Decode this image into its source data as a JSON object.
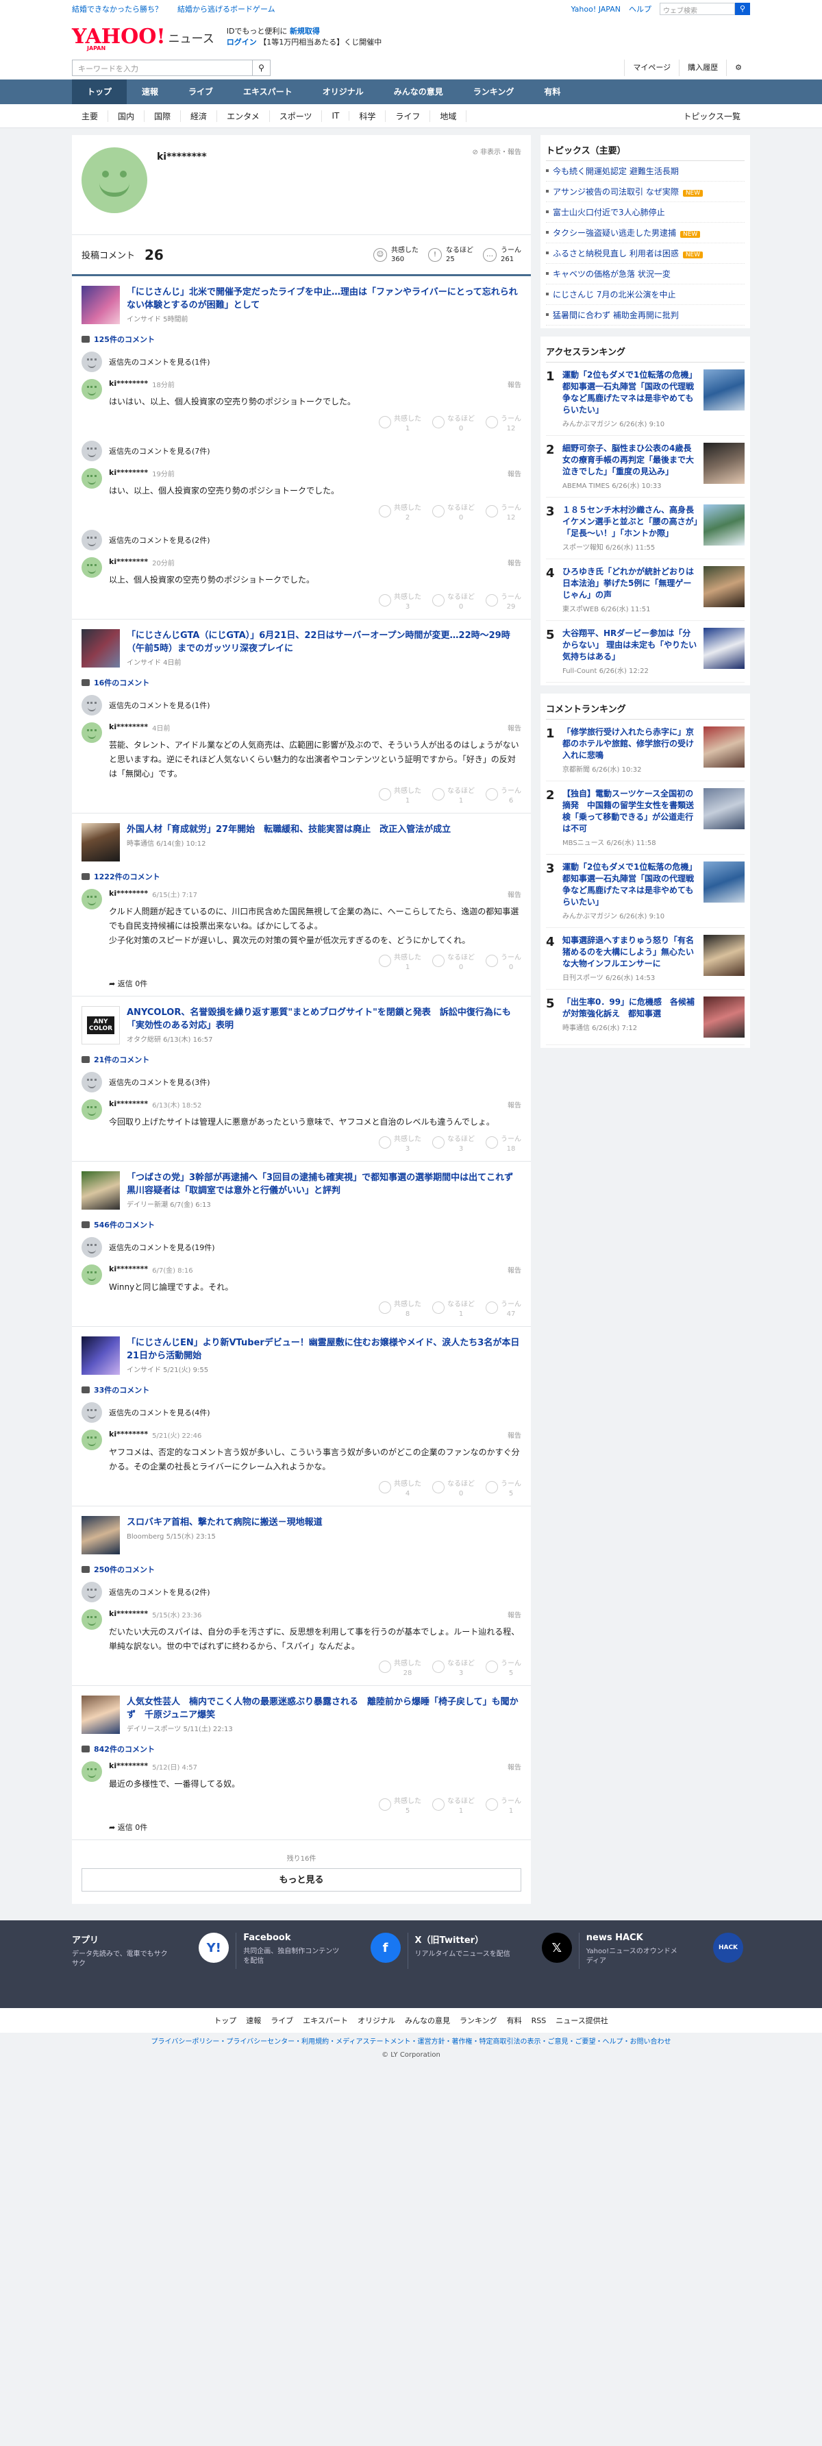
{
  "topbar": {
    "link1": "結婚できなかったら勝ち？",
    "link2": "結婚から逃げるボードゲーム",
    "yjapan": "Yahoo! JAPAN",
    "help": "ヘルプ",
    "search_placeholder": "ウェブ検索"
  },
  "logo": {
    "main": "YAHOO!",
    "sub": "JAPAN",
    "news": "ニュース"
  },
  "promo": {
    "line1_a": "IDでもっと便利に",
    "line1_b": "新規取得",
    "line2_a": "ログイン",
    "line2_b": "【1等1万円相当あたる】くじ開催中"
  },
  "search": {
    "placeholder": "キーワードを入力",
    "mypage": "マイページ",
    "history": "購入履歴"
  },
  "nav": [
    "トップ",
    "速報",
    "ライブ",
    "エキスパート",
    "オリジナル",
    "みんなの意見",
    "ランキング",
    "有料"
  ],
  "subnav": [
    "主要",
    "国内",
    "国際",
    "経済",
    "エンタメ",
    "スポーツ",
    "IT",
    "科学",
    "ライフ",
    "地域"
  ],
  "subnav_right": "トピックス一覧",
  "profile": {
    "name": "ki********",
    "hidden": "非表示・報告",
    "comments_label": "投稿コメント",
    "comments_count": "26",
    "reactions": [
      {
        "label": "共感した",
        "value": "360"
      },
      {
        "label": "なるほど",
        "value": "25"
      },
      {
        "label": "うーん",
        "value": "261"
      }
    ]
  },
  "articles": [
    {
      "title": "「にじさんじ」北米で開催予定だったライブを中止…理由は「ファンやライバーにとって忘れられない体験とするのが困難」として",
      "meta": "インサイド 5時間前",
      "ccount": "125件のコメント",
      "items": [
        {
          "parent": "返信先のコメントを見る(1件)",
          "time": "18分前",
          "text": "はいはい、以上、個人投資家の空売り勢のポジショトークでした。",
          "r": [
            "1",
            "0",
            "12"
          ]
        },
        {
          "parent": "返信先のコメントを見る(7件)",
          "time": "19分前",
          "text": "はい、以上、個人投資家の空売り勢のポジショトークでした。",
          "r": [
            "2",
            "0",
            "12"
          ]
        },
        {
          "parent": "返信先のコメントを見る(2件)",
          "time": "20分前",
          "text": "以上、個人投資家の空売り勢のポジショトークでした。",
          "r": [
            "3",
            "0",
            "29"
          ]
        }
      ]
    },
    {
      "title": "「にじさんじGTA（にじGTA）」6月21日、22日はサーバーオープン時間が変更…22時〜29時（午前5時）までのガッツリ深夜プレイに",
      "meta": "インサイド 4日前",
      "ccount": "16件のコメント",
      "items": [
        {
          "parent": "返信先のコメントを見る(1件)",
          "time": "4日前",
          "text": "芸能、タレント、アイドル業などの人気商売は、広範囲に影響が及ぶので、そういう人が出るのはしょうがないと思いますね。逆にそれほど人気ないくらい魅力的な出演者やコンテンツという証明ですから。「好き」の反対は「無関心」です。",
          "r": [
            "1",
            "1",
            "6"
          ]
        }
      ]
    },
    {
      "title": "外国人材「育成就労」27年開始　転職緩和、技能実習は廃止　改正入管法が成立",
      "meta": "時事通信 6/14(金) 10:12",
      "ccount": "1222件のコメント",
      "items": [
        {
          "parent": "",
          "time": "6/15(土) 7:17",
          "text": "クルド人問題が起きているのに、川口市民含めた国民無視して企業の為に、へーこらしてたら、逸迦の都知事選でも自民支持候補には投票出来ないね。ばかにしてるよ。\n少子化対策のスピードが遅いし、異次元の対策の質や量が低次元すぎるのを、どうにかしてくれ。",
          "r": [
            "1",
            "0",
            "0"
          ],
          "reply": "返信 0件"
        }
      ]
    },
    {
      "title": "ANYCOLOR、名誉毀損を繰り返す悪質\"まとめブログサイト\"を閉鎖と発表　訴訟中復行為にも「実効性のある対応」表明",
      "meta": "オタク総研 6/13(木) 16:57",
      "ccount": "21件のコメント",
      "items": [
        {
          "parent": "返信先のコメントを見る(3件)",
          "time": "6/13(木) 18:52",
          "text": "今回取り上げたサイトは管理人に悪意があったという意味で、ヤフコメと自治のレベルも違うんでしょ。",
          "r": [
            "3",
            "3",
            "18"
          ]
        }
      ]
    },
    {
      "title": "「つばさの党」3幹部が再逮捕へ「3回目の逮捕も確実視」で都知事選の選挙期間中は出てこれず　黒川容疑者は「取調室では意外と行儀がいい」と評判",
      "meta": "デイリー新潮 6/7(金) 6:13",
      "ccount": "546件のコメント",
      "items": [
        {
          "parent": "返信先のコメントを見る(19件)",
          "time": "6/7(金) 8:16",
          "text": "Winnyと同じ論理ですよ。それ。",
          "r": [
            "8",
            "1",
            "47"
          ]
        }
      ]
    },
    {
      "title": "「にじさんじEN」より新VTuberデビュー！幽霊屋敷に住むお嬢様やメイド、涙人たち3名が本日21日から活動開始",
      "meta": "インサイド 5/21(火) 9:55",
      "ccount": "33件のコメント",
      "items": [
        {
          "parent": "返信先のコメントを見る(4件)",
          "time": "5/21(火) 22:46",
          "text": "ヤフコメは、否定的なコメント言う奴が多いし、こういう事言う奴が多いのがどこの企業のファンなのかすぐ分かる。その企業の社長とライバーにクレーム入れようかな。",
          "r": [
            "4",
            "0",
            "5"
          ]
        }
      ]
    },
    {
      "title": "スロバキア首相、撃たれて病院に搬送－現地報道",
      "meta": "Bloomberg 5/15(水) 23:15",
      "ccount": "250件のコメント",
      "items": [
        {
          "parent": "返信先のコメントを見る(2件)",
          "time": "5/15(水) 23:36",
          "text": "だいたい大元のスパイは、自分の手を汚さずに、反思想を利用して事を行うのが基本でしょ。ルート辿れる程、単純な訳ない。世の中でばれずに終わるから、「スパイ」なんだよ。",
          "r": [
            "28",
            "3",
            "5"
          ]
        }
      ]
    },
    {
      "title": "人気女性芸人　楠内でこく人物の最悪迷惑ぶり暴露される　離陸前から爆睡「椅子戻して」も聞かず　千原ジュニア爆笑",
      "meta": "デイリースポーツ 5/11(土) 22:13",
      "ccount": "842件のコメント",
      "items": [
        {
          "parent": "",
          "time": "5/12(日) 4:57",
          "text": "最近の多様性で、一番得してる奴。",
          "r": [
            "5",
            "1",
            "1"
          ],
          "reply": "返信 0件"
        }
      ]
    }
  ],
  "more": {
    "remaining": "残り16件",
    "button": "もっと見る"
  },
  "topics": {
    "title": "トピックス（主要）",
    "items": [
      {
        "t": "今も続く開運処認定 避難生活長期",
        "n": ""
      },
      {
        "t": "アサンジ被告の司法取引 なぜ実際",
        "n": "NEW"
      },
      {
        "t": "富士山火口付近で3人心肺停止",
        "n": ""
      },
      {
        "t": "タクシー強盗疑い逃走した男逮捕",
        "n": "NEW"
      },
      {
        "t": "ふるさと納税見直し 利用者は困惑",
        "n": "NEW"
      },
      {
        "t": "キャベツの価格が急落 状況一変",
        "n": ""
      },
      {
        "t": "にじさんじ 7月の北米公演を中止",
        "n": ""
      },
      {
        "t": "猛暑間に合わず 補助金再開に批判",
        "n": ""
      }
    ]
  },
  "access": {
    "title": "アクセスランキング",
    "items": [
      {
        "h": "運動「2位もダメで1位転落の危機」都知事選一石丸陣営「国政の代理戦争など馬鹿げたマネは是非やめてもらいたい」",
        "s": "みんかぶマガジン 6/26(水) 9:10"
      },
      {
        "h": "細野可奈子、脳性まひ公表の4歳長女の療育手帳の再判定「最後まで大泣きでした」「重度の見込み」",
        "s": "ABEMA TIMES 6/26(水) 10:33"
      },
      {
        "h": "１８５センチ木村沙織さん、高身長イケメン選手と並ぶと「腰の高さが」「足長〜い！」「ホントか際」",
        "s": "スポーツ報知 6/26(水) 11:55"
      },
      {
        "h": "ひろゆき氏「どれかが統計どおりは日本法治」挙げた5例に「無理ゲーじゃん」の声",
        "s": "東スポWEB 6/26(水) 11:51"
      },
      {
        "h": "大谷翔平、HRダービー参加は「分からない」 理由は未定も「やりたい気持ちはある」",
        "s": "Full-Count 6/26(水) 12:22"
      }
    ]
  },
  "commentrank": {
    "title": "コメントランキング",
    "items": [
      {
        "h": "「修学旅行受け入れたら赤字に」京都のホテルや旅館、修学旅行の受け入れに悲鳴",
        "s": "京都新聞 6/26(水) 10:32"
      },
      {
        "h": "【独自】電動スーツケース全国初の摘発　中国籍の留学生女性を書類送検「乗って移動できる」が公道走行は不可",
        "s": "MBSニュース 6/26(水) 11:58"
      },
      {
        "h": "運動「2位もダメで1位転落の危機」都知事選一石丸陣営「国政の代理戦争など馬鹿げたマネは是非やめてもらいたい」",
        "s": "みんかぶマガジン 6/26(水) 9:10"
      },
      {
        "h": "知事選辞退へすまりゅう怒り「有名猪めるのを大構にしよう」無心たいな大物インフルエンサーに",
        "s": "日刊スポーツ 6/26(水) 14:53"
      },
      {
        "h": "「出生率0．99」に危機感　各候補が対策強化訴え　都知事選",
        "s": "時事通信 6/26(水) 7:12"
      }
    ]
  },
  "footer": {
    "apps": [
      {
        "t": "アプリ",
        "d": "データ先読みで、電車でもサクサク"
      },
      {
        "t": "Facebook",
        "d": "共同企画、独自制作コンテンツを配信"
      },
      {
        "t": "X（旧Twitter）",
        "d": "リアルタイムでニュースを配信"
      },
      {
        "t": "news HACK",
        "d": "Yahoo!ニュースのオウンドメディア"
      }
    ],
    "links": [
      "トップ",
      "速報",
      "ライブ",
      "エキスパート",
      "オリジナル",
      "みんなの意見",
      "ランキング",
      "有料",
      "RSS",
      "ニュース提供社"
    ],
    "legal": "プライバシーポリシー・プライバシーセンター・利用規約・メディアステートメント・運営方針・著作権・特定商取引法の表示・ご意見・ご要望・ヘルプ・お問い合わせ",
    "copy": "© LY Corporation"
  },
  "labels": {
    "report": "報告",
    "r1": "共感した",
    "r2": "なるほど",
    "r3": "うーん"
  }
}
